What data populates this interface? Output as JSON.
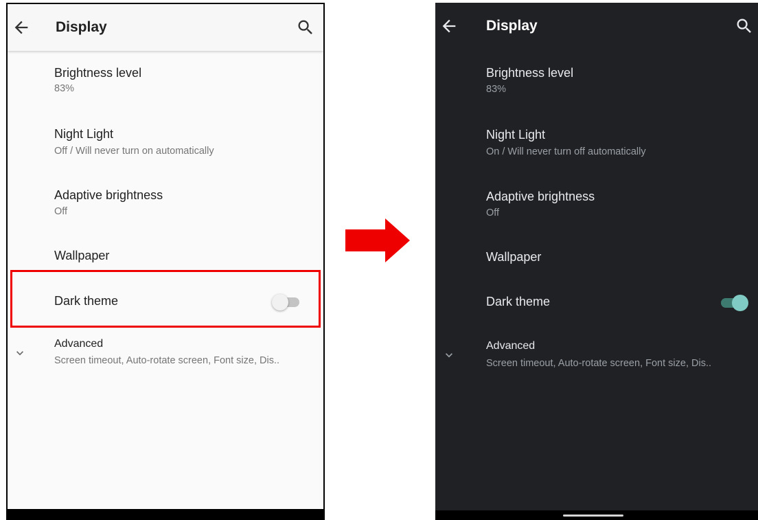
{
  "before_screen": {
    "title": "Display",
    "items": [
      {
        "title": "Brightness level",
        "subtitle": "83%"
      },
      {
        "title": "Night Light",
        "subtitle": "Off / Will never turn on automatically"
      },
      {
        "title": "Adaptive brightness",
        "subtitle": "Off"
      },
      {
        "title": "Wallpaper"
      },
      {
        "title": "Dark theme",
        "toggle_on": false
      },
      {
        "title": "Advanced",
        "subtitle": "Screen timeout, Auto-rotate screen, Font size, Dis.."
      }
    ]
  },
  "after_screen": {
    "title": "Display",
    "items": [
      {
        "title": "Brightness level",
        "subtitle": "83%"
      },
      {
        "title": "Night Light",
        "subtitle": "On / Will never turn off automatically"
      },
      {
        "title": "Adaptive brightness",
        "subtitle": "Off"
      },
      {
        "title": "Wallpaper"
      },
      {
        "title": "Dark theme",
        "toggle_on": true
      },
      {
        "title": "Advanced",
        "subtitle": "Screen timeout, Auto-rotate screen, Font size, Dis.."
      }
    ]
  },
  "icons": {
    "back": "arrow-back-icon",
    "search": "search-icon",
    "expand": "chevron-down-icon",
    "transition": "right-arrow-icon"
  },
  "colors": {
    "highlight": "#ee0000",
    "arrow": "#ee0000",
    "dark_background": "#202124",
    "toggle_on_thumb": "#80cbc4"
  }
}
